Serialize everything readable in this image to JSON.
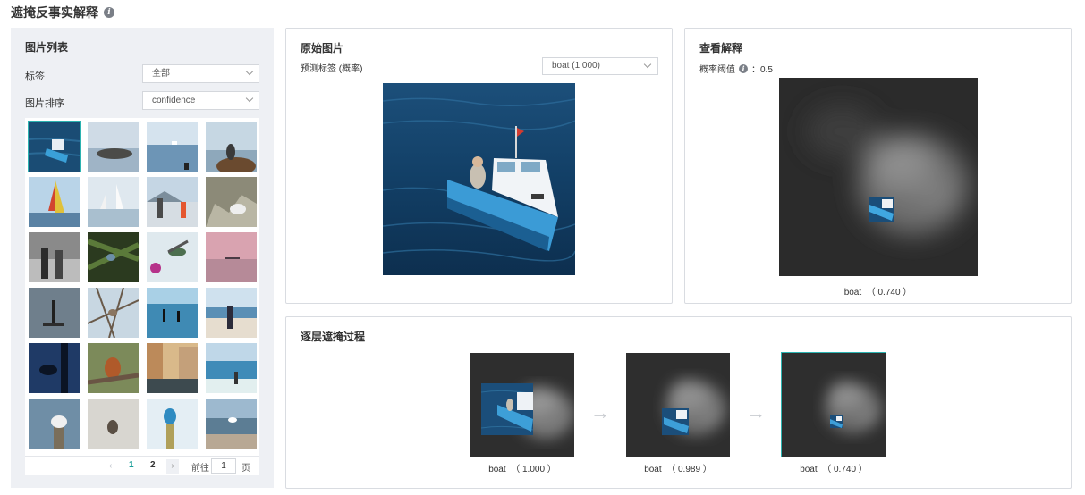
{
  "page": {
    "title": "遮掩反事实解释",
    "info_icon": "info-circle-icon"
  },
  "image_list": {
    "title": "图片列表",
    "filters": [
      {
        "label": "标签",
        "value": "全部"
      },
      {
        "label": "图片排序",
        "value": "confidence"
      }
    ],
    "thumbnails": [
      {
        "subject": "boat",
        "selected": true
      },
      {
        "subject": "rocky-island"
      },
      {
        "subject": "sea-boat"
      },
      {
        "subject": "bird-on-rock"
      },
      {
        "subject": "sailboat"
      },
      {
        "subject": "sailboats-beach"
      },
      {
        "subject": "people-beach"
      },
      {
        "subject": "gull-cliff"
      },
      {
        "subject": "people-street-bw"
      },
      {
        "subject": "bird-pine"
      },
      {
        "subject": "hummingbird"
      },
      {
        "subject": "pink-sunset-sea"
      },
      {
        "subject": "paddleboard"
      },
      {
        "subject": "bird-branches"
      },
      {
        "subject": "paddleboarders"
      },
      {
        "subject": "beach-person"
      },
      {
        "subject": "bird-silhouette"
      },
      {
        "subject": "robin"
      },
      {
        "subject": "canal-houses"
      },
      {
        "subject": "beach-waves"
      },
      {
        "subject": "gull-post"
      },
      {
        "subject": "bird-snow"
      },
      {
        "subject": "kingfisher"
      },
      {
        "subject": "gulls-shore"
      }
    ],
    "pagination": {
      "prev": "‹",
      "pages": [
        "1",
        "2"
      ],
      "current": "1",
      "next": "›",
      "goto_label": "前往",
      "goto_value": "1",
      "unit": "页"
    }
  },
  "original": {
    "title": "原始图片",
    "pred_label": "预测标签 (概率)",
    "pred_value": "boat (1.000)"
  },
  "explanation": {
    "title": "查看解释",
    "threshold_label": "概率阈值",
    "threshold_value": "：0.5",
    "caption": "boat  （ 0.740 ）"
  },
  "progress": {
    "title": "逐层遮掩过程",
    "steps": [
      {
        "caption": "boat  （ 1.000 ）"
      },
      {
        "caption": "boat  （ 0.989 ）"
      },
      {
        "caption": "boat  （ 0.740 ）"
      }
    ],
    "arrow_icon": "arrow-right-icon"
  },
  "colors": {
    "accent": "#1a9e99",
    "panel_bg": "#eef0f4",
    "border": "#d9dce1"
  }
}
